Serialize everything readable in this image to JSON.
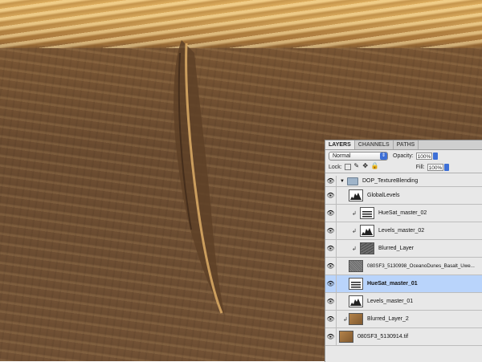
{
  "layers_panel": {
    "tabs": [
      {
        "label": "LAYERS",
        "active": true
      },
      {
        "label": "CHANNELS",
        "active": false
      },
      {
        "label": "PATHS",
        "active": false
      }
    ],
    "blend_mode": "Normal",
    "opacity_label": "Opacity:",
    "opacity_value": "100%",
    "lock_label": "Lock:",
    "fill_label": "Fill:",
    "fill_value": "100%",
    "layers": [
      {
        "name": "DOP_TextureBlending",
        "kind": "group"
      },
      {
        "name": "GlobalLevels",
        "kind": "adjustment"
      },
      {
        "name": "HueSat_master_02",
        "kind": "adjustment"
      },
      {
        "name": "Levels_master_02",
        "kind": "adjustment"
      },
      {
        "name": "Blurred_Layer",
        "kind": "pixel"
      },
      {
        "name": "080SF3_5130998_OceanoDunes_Basalt_Uwe...",
        "kind": "pixel"
      },
      {
        "name": "HueSat_master_01",
        "kind": "adjustment",
        "selected": true
      },
      {
        "name": "Levels_master_01",
        "kind": "adjustment"
      },
      {
        "name": "Blurred_Layer_2",
        "kind": "pixel"
      },
      {
        "name": "080SF3_5130914.tif",
        "kind": "pixel"
      }
    ]
  }
}
